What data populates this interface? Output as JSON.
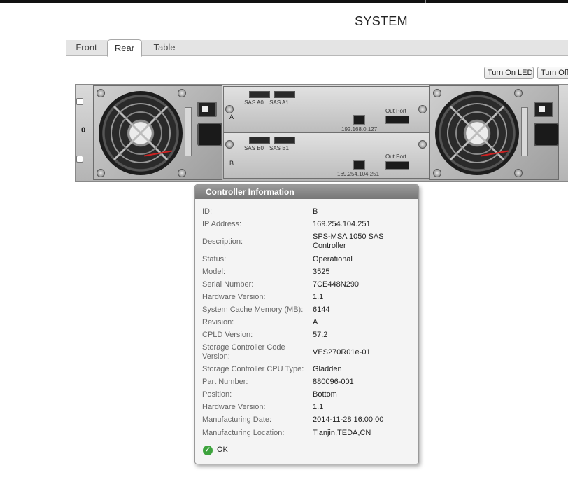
{
  "page": {
    "title": "SYSTEM"
  },
  "tabs": [
    {
      "label": "Front",
      "active": false
    },
    {
      "label": "Rear",
      "active": true
    },
    {
      "label": "Table",
      "active": false
    }
  ],
  "led_buttons": {
    "turn_on": "Turn On LEDs",
    "turn_off": "Turn Off"
  },
  "enclosure": {
    "label": "0",
    "controllers": [
      {
        "letter": "A",
        "ports": [
          "SAS A0",
          "SAS A1"
        ],
        "ip": "192.168.0.127",
        "out_port": "Out Port"
      },
      {
        "letter": "B",
        "ports": [
          "SAS B0",
          "SAS B1"
        ],
        "ip": "169.254.104.251",
        "out_port": "Out Port"
      }
    ]
  },
  "popup": {
    "title": "Controller Information",
    "rows": [
      {
        "label": "ID:",
        "value": "B"
      },
      {
        "label": "IP Address:",
        "value": "169.254.104.251"
      },
      {
        "label": "Description:",
        "value": "SPS-MSA 1050 SAS Controller"
      },
      {
        "label": "Status:",
        "value": "Operational"
      },
      {
        "label": "Model:",
        "value": "3525"
      },
      {
        "label": "Serial Number:",
        "value": "7CE448N290"
      },
      {
        "label": "Hardware Version:",
        "value": "1.1"
      },
      {
        "label": "System Cache Memory (MB):",
        "value": "6144"
      },
      {
        "label": "Revision:",
        "value": "A"
      },
      {
        "label": "CPLD Version:",
        "value": "57.2"
      },
      {
        "label": "Storage Controller Code Version:",
        "value": "VES270R01e-01"
      },
      {
        "label": "Storage Controller CPU Type:",
        "value": "Gladden"
      },
      {
        "label": "Part Number:",
        "value": "880096-001"
      },
      {
        "label": "Position:",
        "value": "Bottom"
      },
      {
        "label": "Hardware Version:",
        "value": "1.1"
      },
      {
        "label": "Manufacturing Date:",
        "value": "2014-11-28 16:00:00"
      },
      {
        "label": "Manufacturing Location:",
        "value": "Tianjin,TEDA,CN"
      }
    ],
    "health": {
      "icon": "check-circle-icon",
      "label": "OK",
      "color": "#3da33d"
    }
  }
}
